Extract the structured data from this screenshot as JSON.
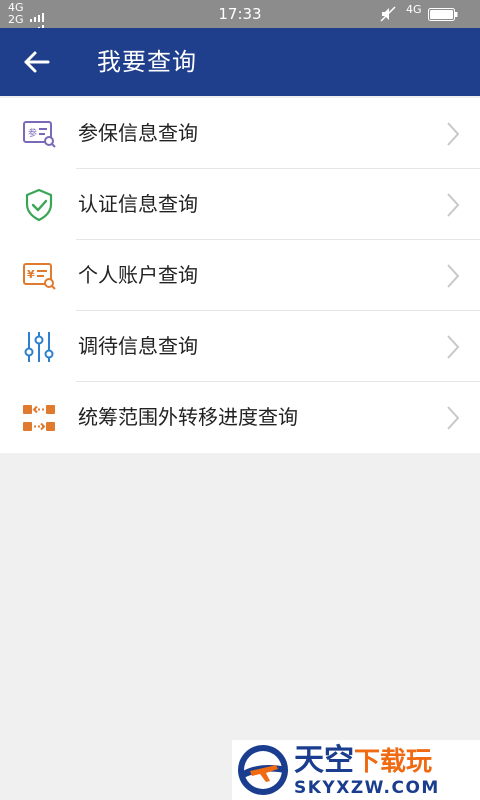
{
  "status_bar": {
    "net_top": "4G",
    "net_bottom": "2G",
    "time": "17:33",
    "net_right": "4G"
  },
  "header": {
    "title": "我要查询",
    "back_icon": "arrow-left-icon",
    "background": "#1f3f8c"
  },
  "menu": {
    "items": [
      {
        "label": "参保信息查询",
        "icon": "insurance-card-search-icon",
        "color": "#7a68b8"
      },
      {
        "label": "认证信息查询",
        "icon": "shield-check-icon",
        "color": "#3aa655"
      },
      {
        "label": "个人账户查询",
        "icon": "yuan-card-search-icon",
        "color": "#e07a2e"
      },
      {
        "label": "调待信息查询",
        "icon": "sliders-icon",
        "color": "#2f7fd0"
      },
      {
        "label": "统筹范围外转移进度查询",
        "icon": "transfer-arrows-icon",
        "color": "#e07a2e"
      }
    ],
    "chevron_icon": "chevron-right-icon"
  },
  "watermark": {
    "title_part1": "天空",
    "title_part2": "下载玩",
    "url": "SKYXZW.COM"
  }
}
